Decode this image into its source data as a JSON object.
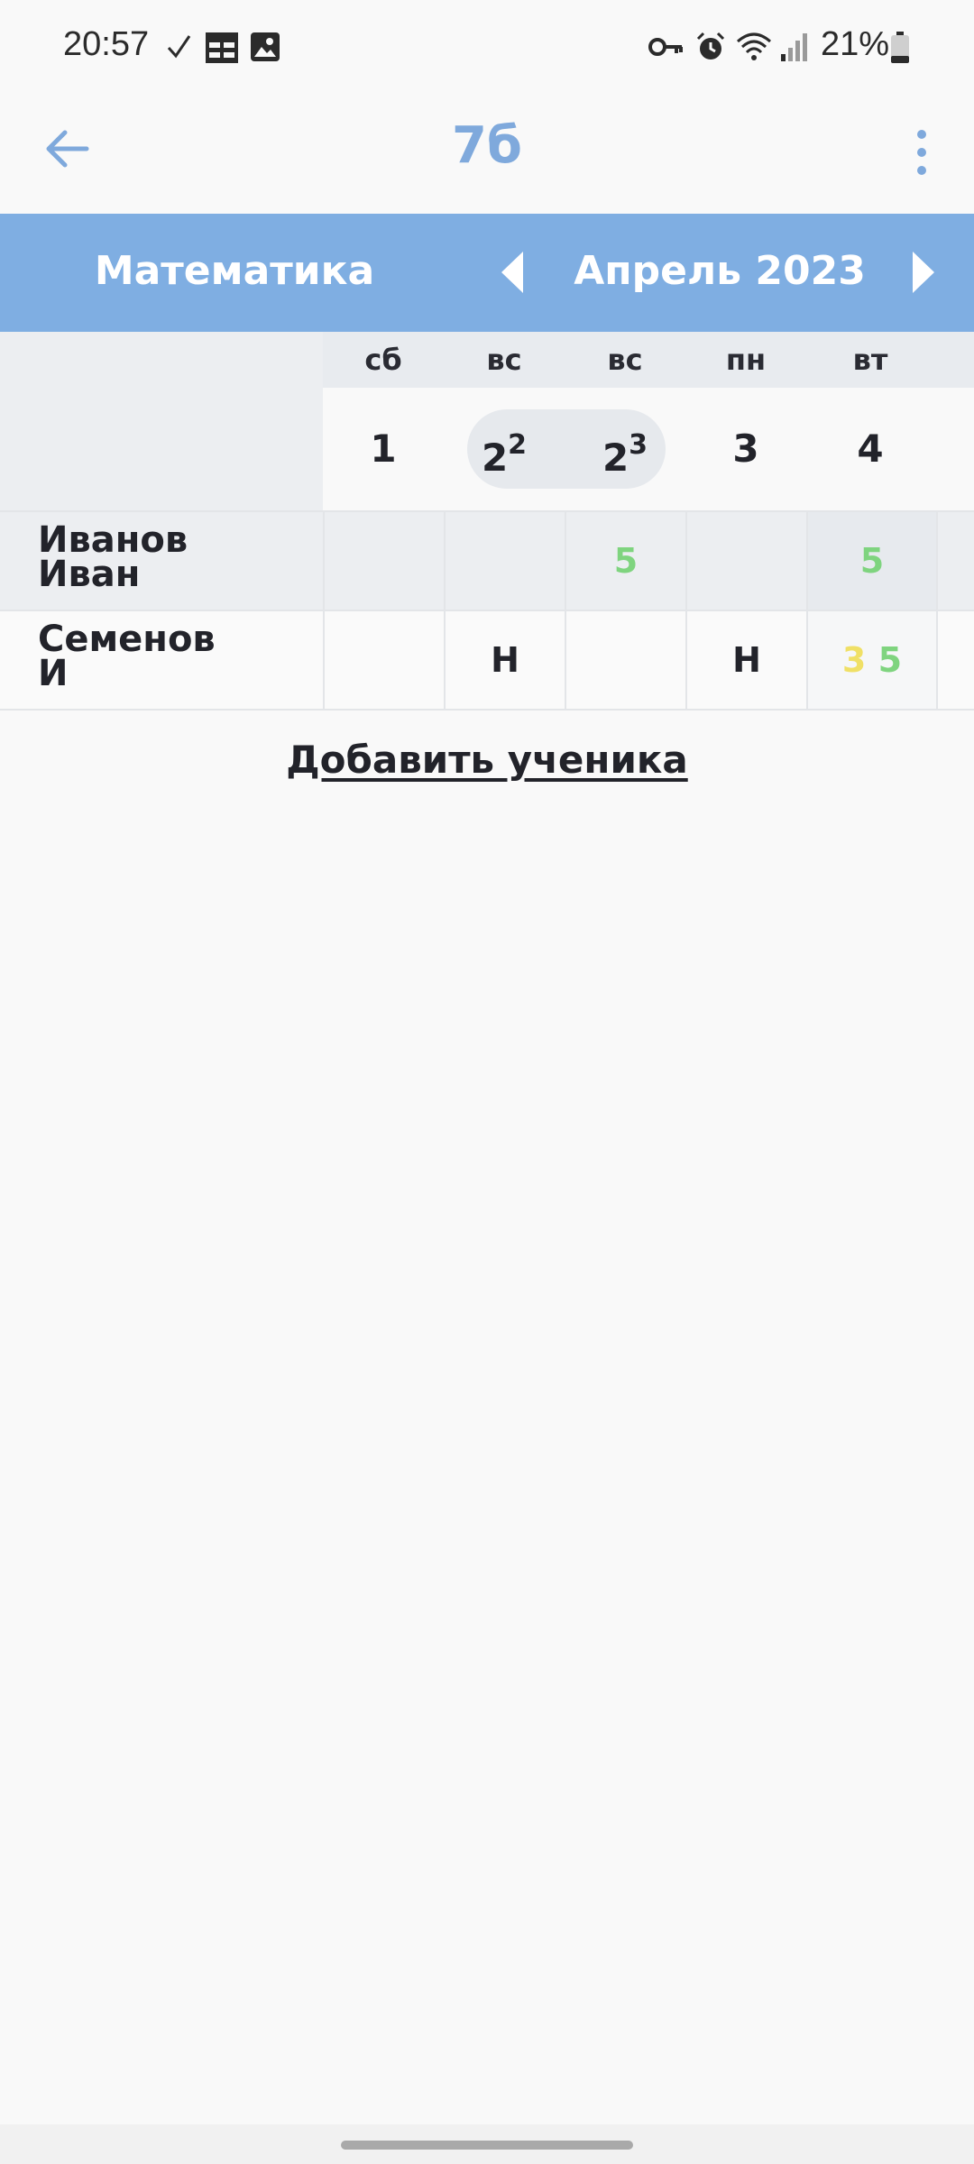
{
  "status_bar": {
    "time": "20:57",
    "battery": "21%",
    "icons": [
      "check-icon",
      "grid-icon",
      "image-icon",
      "key-icon",
      "alarm-icon",
      "wifi-icon",
      "signal-icon",
      "battery-icon"
    ]
  },
  "app_bar": {
    "title": "7б",
    "back_icon": "arrow-left-icon",
    "menu_icon": "more-vert-icon"
  },
  "colors": {
    "accent": "#7faee2",
    "title": "#7fa9dc",
    "grade_green": "#7fd47f",
    "grade_yellow": "#f0e066"
  },
  "header": {
    "subject": "Математика",
    "month": "Апрель 2023"
  },
  "columns": [
    {
      "day": "сб",
      "date": "1",
      "lesson": ""
    },
    {
      "day": "вс",
      "date": "2",
      "lesson": "2"
    },
    {
      "day": "вс",
      "date": "2",
      "lesson": "3"
    },
    {
      "day": "пн",
      "date": "3",
      "lesson": ""
    },
    {
      "day": "вт",
      "date": "4",
      "lesson": ""
    }
  ],
  "students": [
    {
      "first": "Иванов",
      "second": "Иван",
      "marks": [
        "",
        "",
        "5",
        "",
        "5"
      ]
    },
    {
      "first": "Семенов",
      "second": "И",
      "marks": [
        "",
        "Н",
        "",
        "Н",
        "3"
      ],
      "extra_mark": "5"
    }
  ],
  "add_student": "Добавить ученика"
}
